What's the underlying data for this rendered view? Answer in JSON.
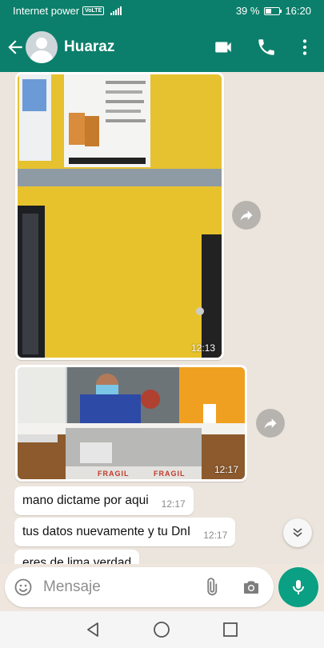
{
  "status_bar": {
    "carrier": "Internet power",
    "network_badge": "VoLTE",
    "battery_percent": "39 %",
    "battery_level": 0.39,
    "time": "16:20"
  },
  "header": {
    "back_icon": "arrow-left-icon",
    "contact_name": "Huaraz",
    "video_icon": "videocam-icon",
    "call_icon": "phone-icon",
    "more_icon": "more-vert-icon"
  },
  "messages": [
    {
      "type": "image",
      "time": "12:13",
      "forward_icon": "forward-icon"
    },
    {
      "type": "image",
      "time": "12:17",
      "forward_icon": "forward-icon",
      "photo_labels": [
        "FRAGIL",
        "FRAGIL"
      ]
    },
    {
      "type": "text",
      "text": "mano dictame por aqui",
      "time": "12:17"
    },
    {
      "type": "text",
      "text": "tus datos nuevamente y tu DnI",
      "time": "12:17"
    },
    {
      "type": "text",
      "text": "eres de lima verdad",
      "time": ""
    }
  ],
  "composer": {
    "placeholder": "Mensaje",
    "emoji_icon": "emoji-icon",
    "attach_icon": "paperclip-icon",
    "camera_icon": "camera-icon",
    "mic_icon": "mic-icon",
    "scroll_down_icon": "chevron-double-down-icon"
  },
  "nav_bar": {
    "back_icon": "triangle-back-icon",
    "home_icon": "circle-home-icon",
    "recents_icon": "square-recents-icon"
  },
  "colors": {
    "header": "#0b7f6b",
    "mic_button": "#0b9f83",
    "chat_background": "#ece5dd"
  }
}
